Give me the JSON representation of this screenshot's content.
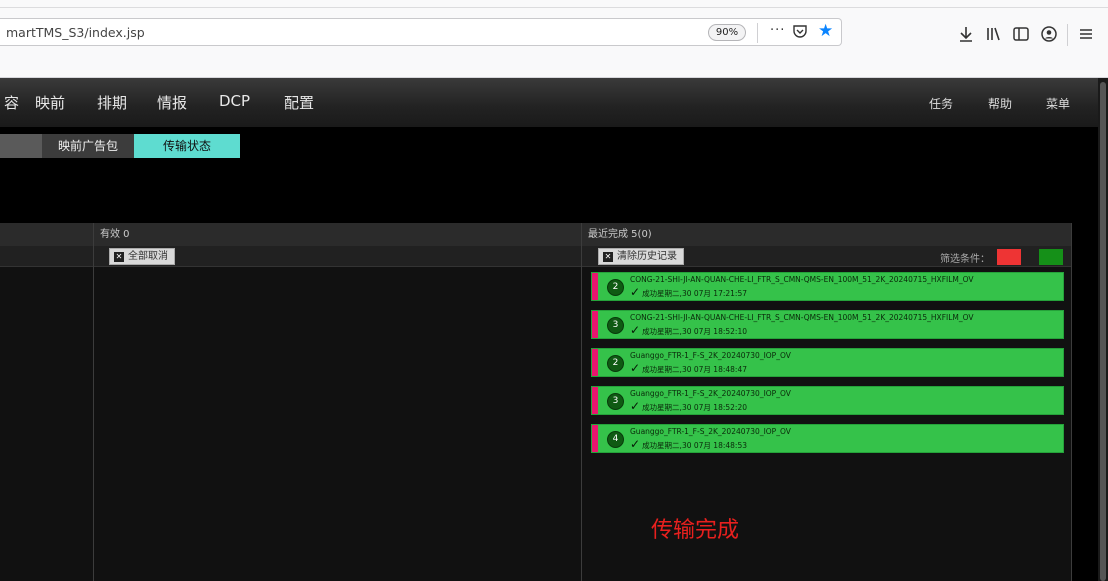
{
  "browser": {
    "url": "martTMS_S3/index.jsp",
    "zoom": "90%",
    "more_glyph": "···",
    "icons": [
      "more-icon",
      "pocket-icon",
      "bookmark-star-icon",
      "download-icon",
      "library-icon",
      "sidebar-icon",
      "account-icon",
      "menu-icon"
    ]
  },
  "nav": {
    "items": [
      "容",
      "映前",
      "排期",
      "情报",
      "DCP",
      "配置"
    ],
    "right": [
      "任务",
      "帮助",
      "菜单"
    ]
  },
  "subtabs": [
    "映前广告包",
    "传输状态"
  ],
  "active_subtab": "传输状态",
  "panels": {
    "valid": {
      "title": "有效 0",
      "cancel_all": "全部取消"
    },
    "recent": {
      "title": "最近完成 5(0)",
      "clear_history": "清除历史记录",
      "filter_label": "筛选条件：",
      "filter_colors": [
        "#ee3434",
        "#159018"
      ]
    }
  },
  "transfers": [
    {
      "num": "2",
      "name": "CONG-21-SHI-JI-AN-QUAN-CHE-LI_FTR_S_CMN-QMS-EN_100M_51_2K_20240715_HXFILM_OV",
      "status": "成功星期二,30 07月 17:21:57"
    },
    {
      "num": "3",
      "name": "CONG-21-SHI-JI-AN-QUAN-CHE-LI_FTR_S_CMN-QMS-EN_100M_51_2K_20240715_HXFILM_OV",
      "status": "成功星期二,30 07月 18:52:10"
    },
    {
      "num": "2",
      "name": "Guanggo_FTR-1_F-S_2K_20240730_IOP_OV",
      "status": "成功星期二,30 07月 18:48:47"
    },
    {
      "num": "3",
      "name": "Guanggo_FTR-1_F-S_2K_20240730_IOP_OV",
      "status": "成功星期二,30 07月 18:52:20"
    },
    {
      "num": "4",
      "name": "Guanggo_FTR-1_F-S_2K_20240730_IOP_OV",
      "status": "成功星期二,30 07月 18:48:53"
    }
  ],
  "overlay_text": "传输完成",
  "colors": {
    "active_tab": "#5edcd0",
    "item_green": "#35c24a",
    "item_stripe": "#e8166e",
    "overlay_red": "#e8201e"
  }
}
